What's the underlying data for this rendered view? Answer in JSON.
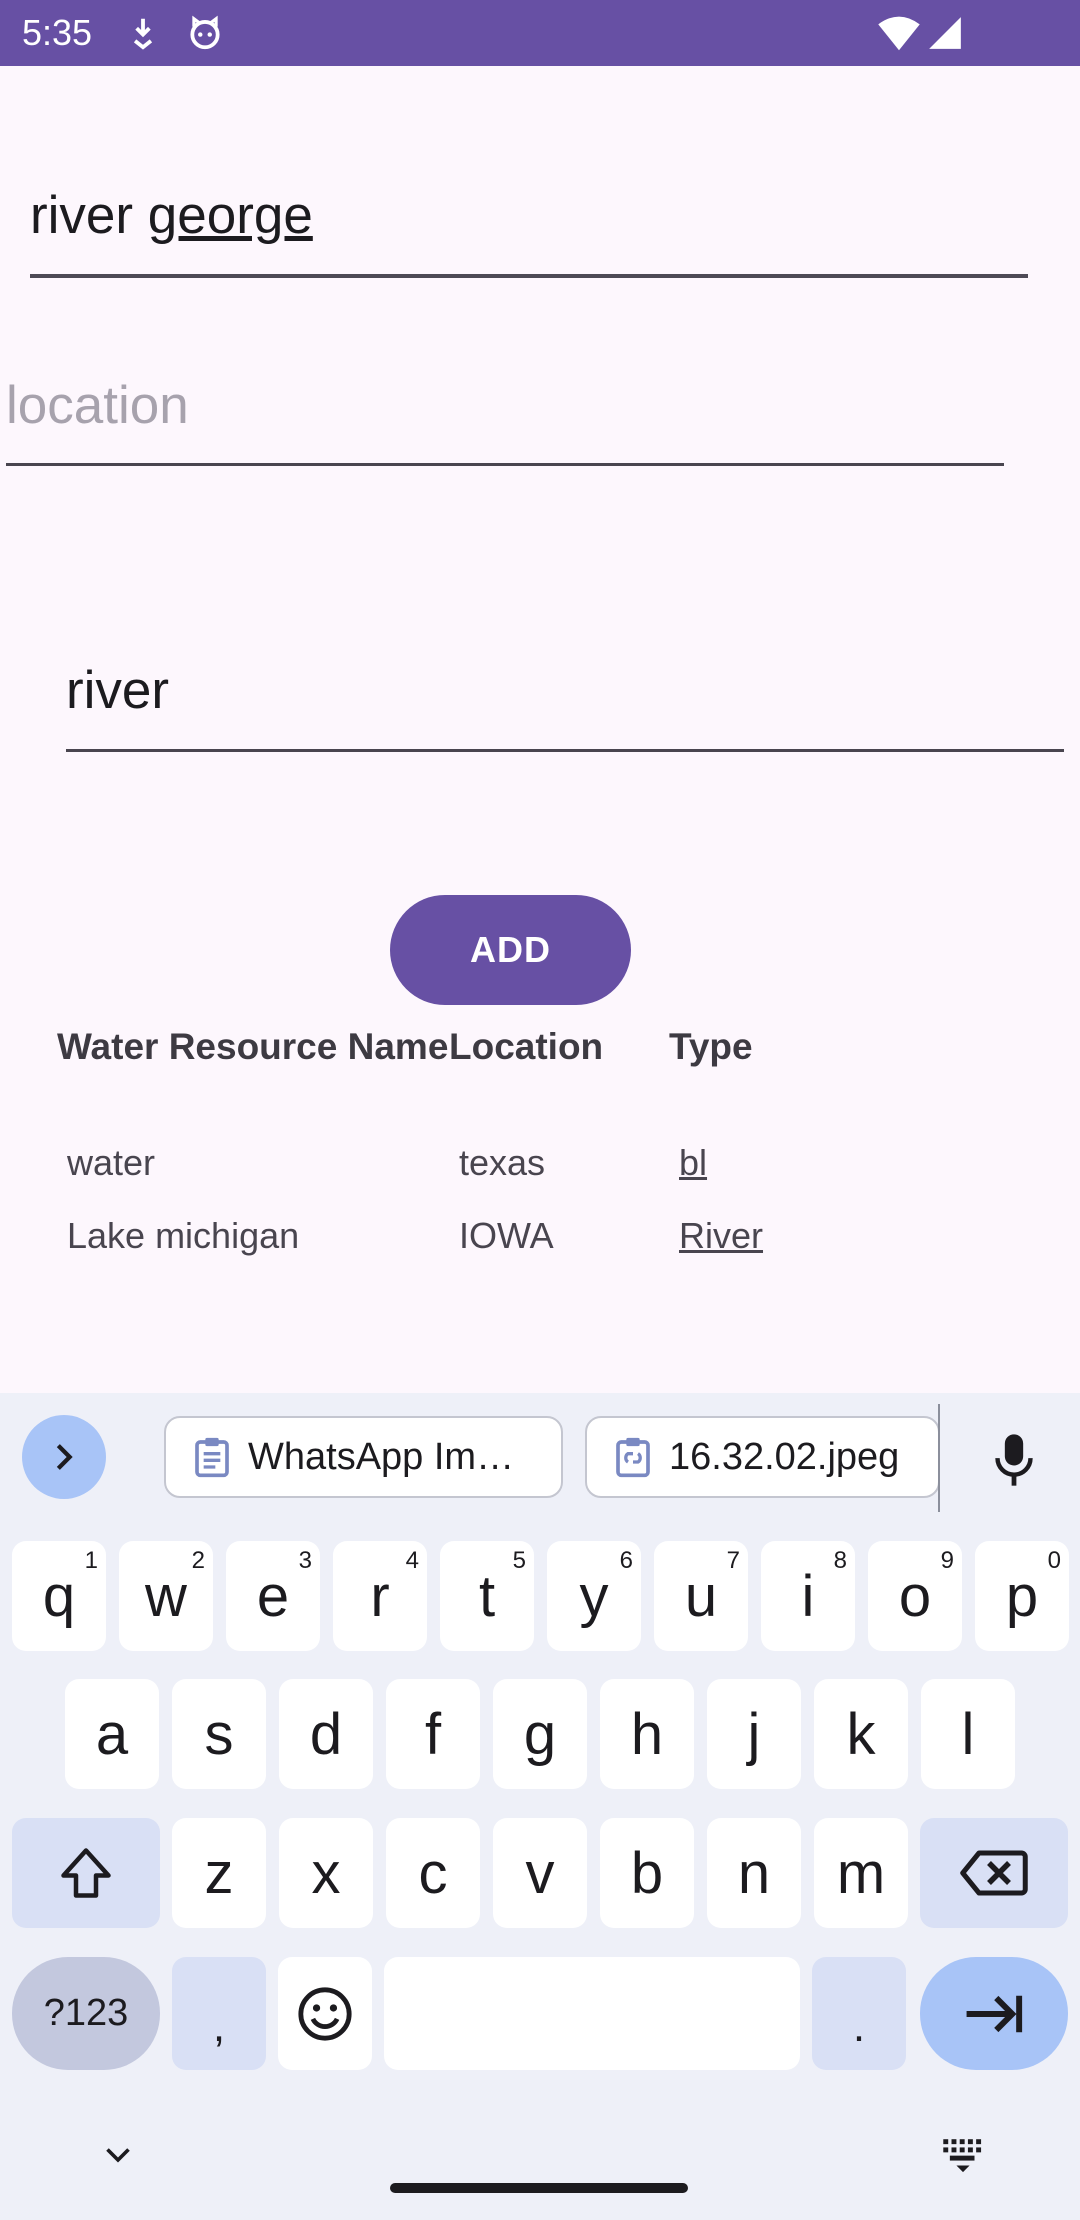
{
  "status_bar": {
    "time": "5:35",
    "icons": [
      "download-icon",
      "cat-face-icon",
      "wifi-icon",
      "cell-signal-icon"
    ]
  },
  "form": {
    "name_value_first": "river ",
    "name_value_second": "george",
    "location_placeholder": "location",
    "type_value": "river",
    "add_label": "ADD"
  },
  "table": {
    "headers": [
      "Water Resource Name",
      "Location",
      "Type"
    ],
    "rows": [
      [
        "water",
        "texas",
        "bl"
      ],
      [
        "Lake michigan",
        "IOWA",
        "River"
      ]
    ]
  },
  "keyboard": {
    "clipboard_chips": [
      "WhatsApp Im…",
      "16.32.02.jpeg"
    ],
    "row1": [
      "q",
      "w",
      "e",
      "r",
      "t",
      "y",
      "u",
      "i",
      "o",
      "p"
    ],
    "row1_hints": [
      "1",
      "2",
      "3",
      "4",
      "5",
      "6",
      "7",
      "8",
      "9",
      "0"
    ],
    "row2": [
      "a",
      "s",
      "d",
      "f",
      "g",
      "h",
      "j",
      "k",
      "l"
    ],
    "row3": [
      "z",
      "x",
      "c",
      "v",
      "b",
      "n",
      "m"
    ],
    "symbols_label": "?123",
    "comma": ",",
    "period": "."
  },
  "colors": {
    "primary": "#6750a4",
    "background": "#fdf7fd",
    "keyboard_bg": "#eef0f8",
    "enter_key": "#a8c4f7"
  }
}
